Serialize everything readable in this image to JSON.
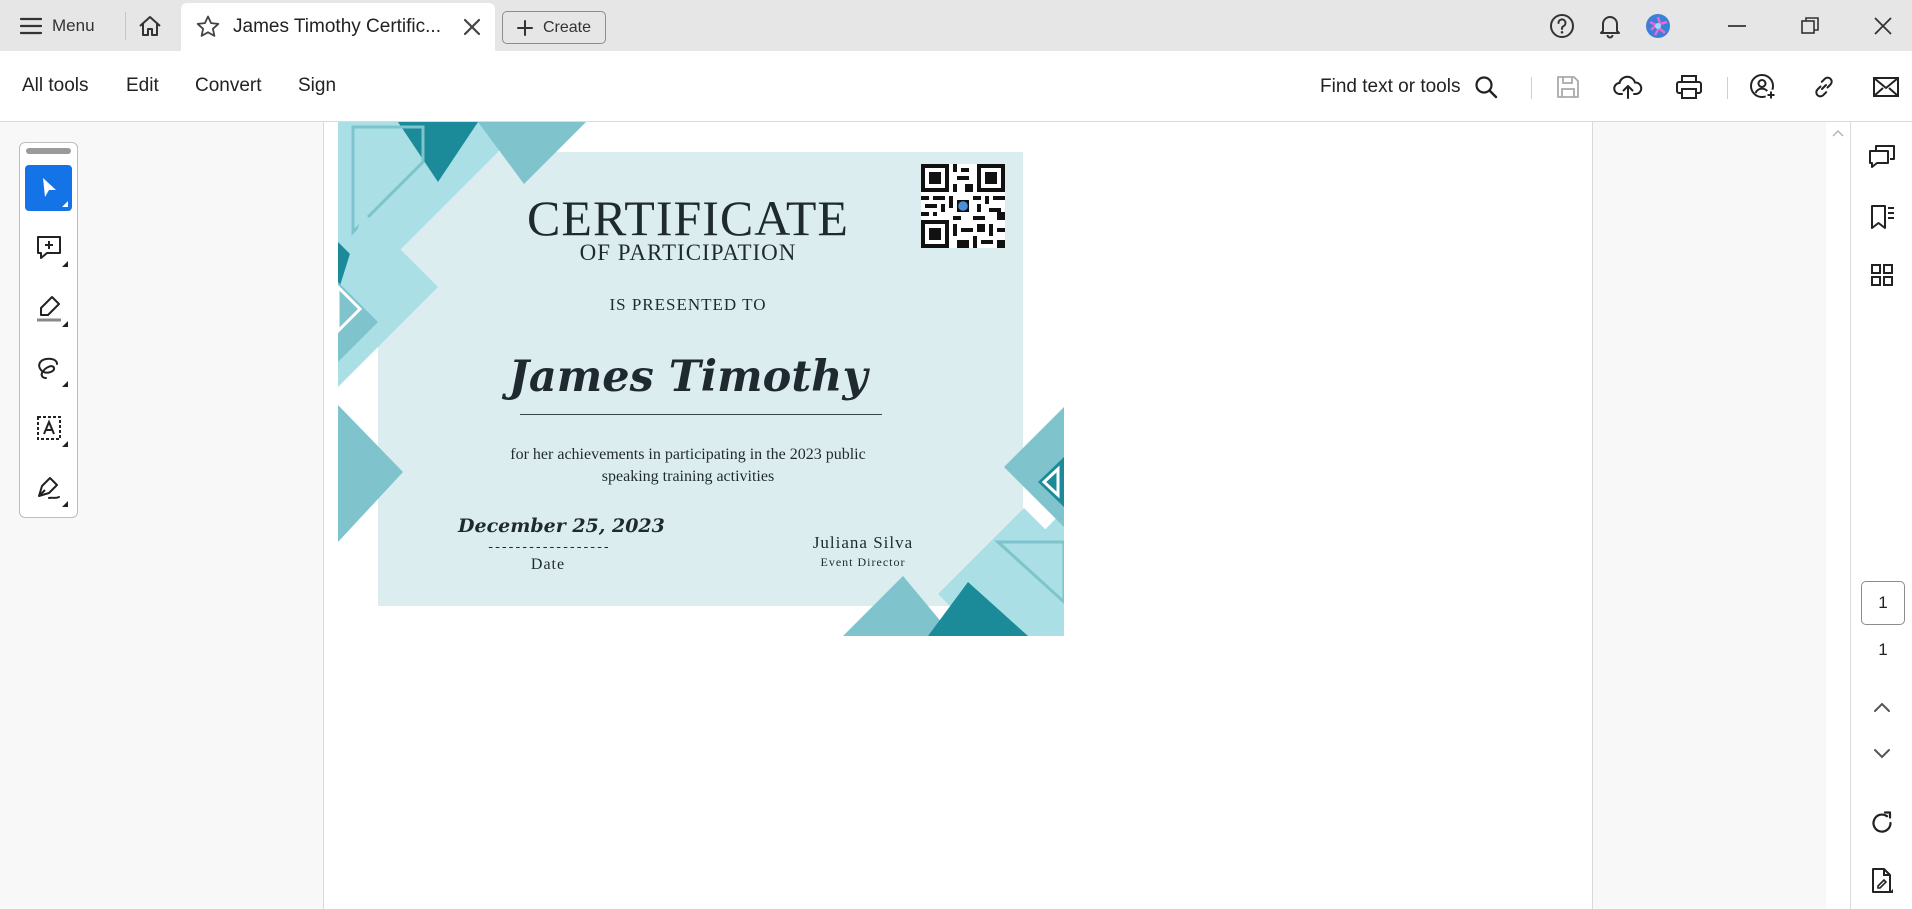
{
  "titlebar": {
    "menu_label": "Menu",
    "tab_title": "James Timothy Certific...",
    "create_label": "Create"
  },
  "toolbar": {
    "tabs": [
      "All tools",
      "Edit",
      "Convert",
      "Sign"
    ],
    "find_label": "Find text or tools"
  },
  "certificate": {
    "title": "CERTIFICATE",
    "subtitle": "OF PARTICIPATION",
    "presented": "IS PRESENTED TO",
    "name": "James Timothy",
    "description": "for her achievements in participating in the 2023 public speaking training activities",
    "date": "December 25, 2023",
    "date_dashes": "------------------",
    "date_label": "Date",
    "signer": "Juliana Silva",
    "signer_role": "Event Director"
  },
  "pagination": {
    "current_page": "1",
    "total_pages": "1"
  },
  "colors": {
    "accent": "#1473e6",
    "teal_dark": "#1b8b99",
    "teal_mid": "#7fc3cc",
    "teal_light": "#a9dfe5",
    "certificate_bg": "#dcedf0"
  }
}
